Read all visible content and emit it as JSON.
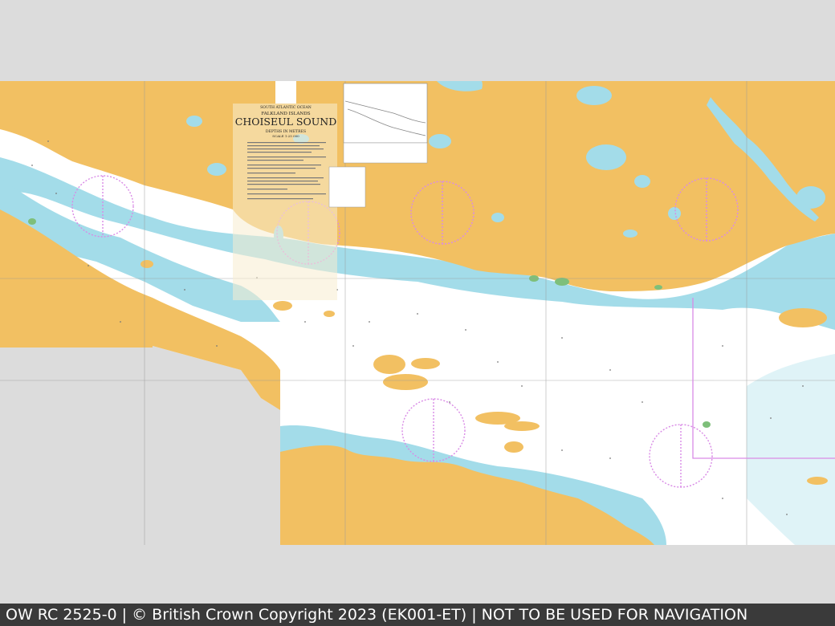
{
  "footer": {
    "text": "OW RC 2525-0 | © British Crown Copyright 2023 (EK001-ET) | NOT TO BE USED FOR NAVIGATION"
  },
  "chart": {
    "region_line1": "SOUTH ATLANTIC OCEAN",
    "region_line2": "FALKLAND ISLANDS",
    "title": "CHOISEUL SOUND",
    "depths_note": "DEPTHS IN METRES",
    "scale_note": "SCALE 1:25 000"
  },
  "colors": {
    "land": "#f2c062",
    "shallow_water": "#a3dce9",
    "deep_water": "#ffffff",
    "drying": "#7ebf7a",
    "compass": "#d98ae6",
    "background": "#dcdcdc",
    "footer": "#3a3a3a"
  }
}
